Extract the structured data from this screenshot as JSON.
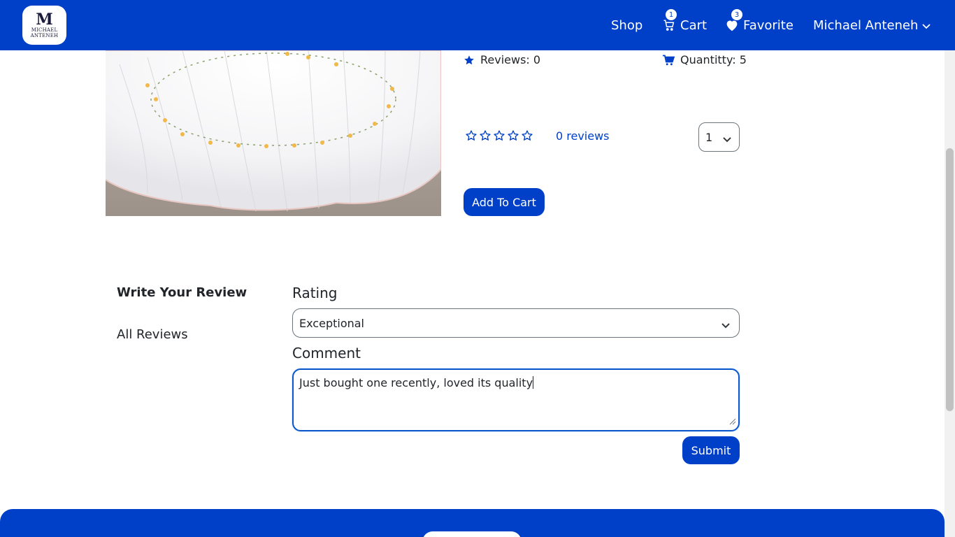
{
  "navbar": {
    "logo_mark": "M",
    "logo_line1": "MICHAEL",
    "logo_line2": "ANTENEH",
    "shop_label": "Shop",
    "cart_label": "Cart",
    "cart_count": "1",
    "favorite_label": "Favorite",
    "favorite_count": "3",
    "user_label": "Michael Anteneh"
  },
  "product": {
    "reviews_label": "Reviews: 0",
    "quantity_label": "Quantitty: 5",
    "rating_stars": 0,
    "reviews_link": "0 reviews",
    "qty_selected": "1",
    "add_to_cart_label": "Add To Cart"
  },
  "review": {
    "tab_write": "Write Your Review",
    "tab_all": "All Reviews",
    "rating_label": "Rating",
    "rating_value": "Exceptional",
    "comment_label": "Comment",
    "comment_value": "Just bought one recently, loved its quality",
    "submit_label": "Submit"
  },
  "colors": {
    "primary": "#0040c9",
    "focus_border": "#0a58ca"
  }
}
